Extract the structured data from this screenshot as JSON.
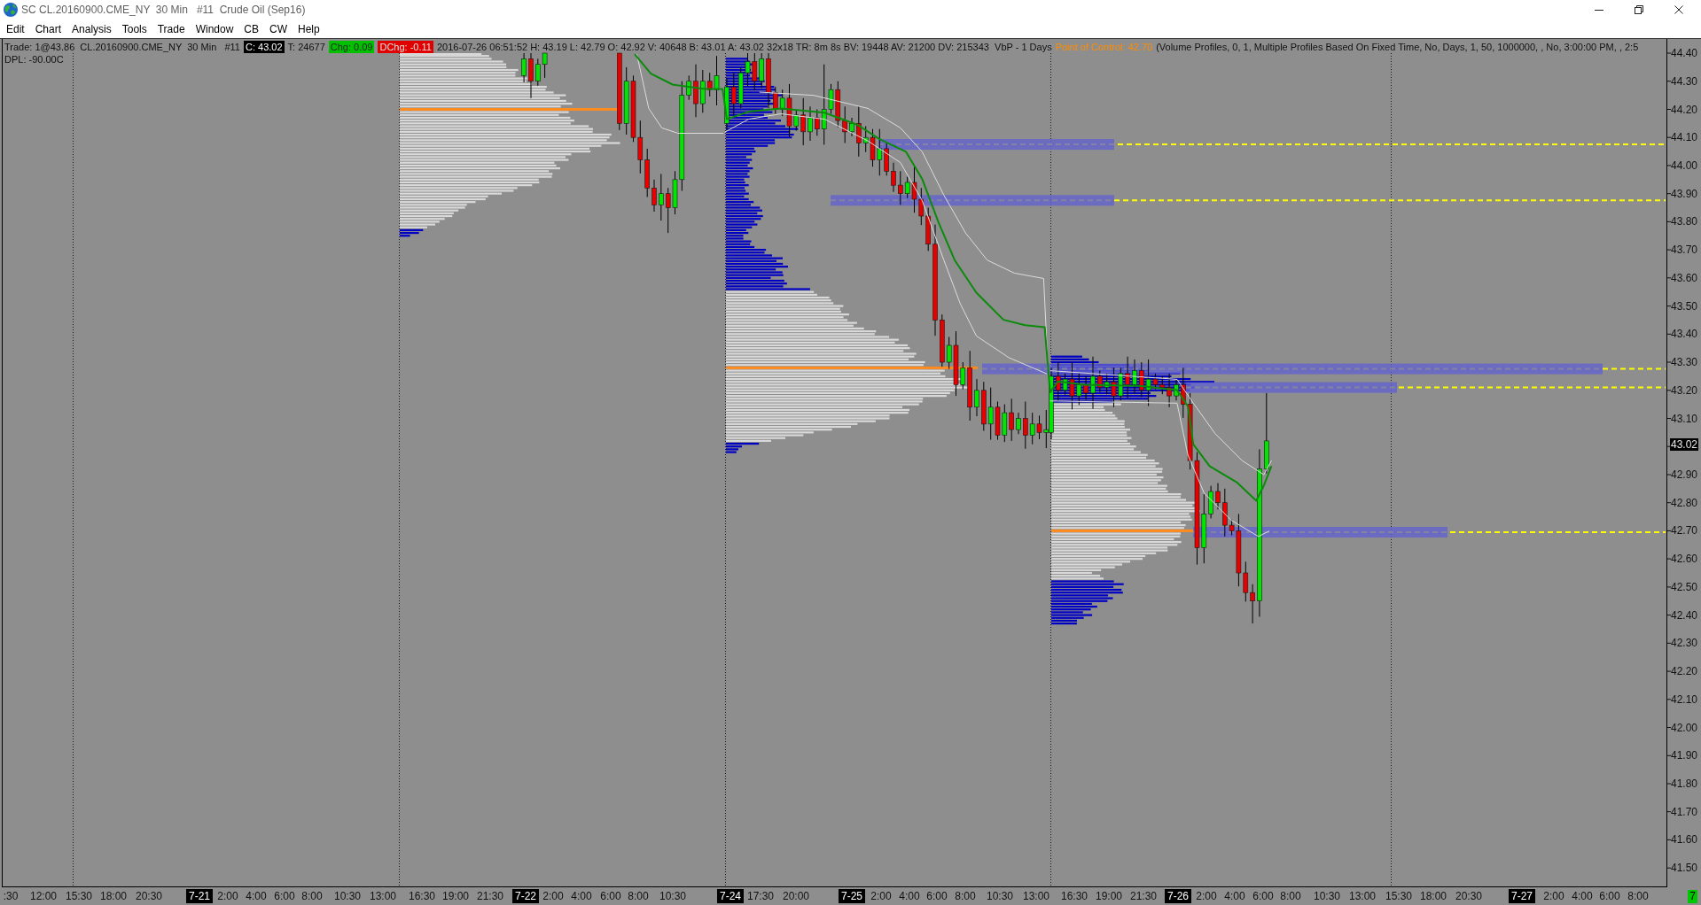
{
  "window": {
    "title": "SC CL.20160900.CME_NY  30 Min   #11  Crude Oil (Sep16)"
  },
  "menu": [
    "Edit",
    "Chart",
    "Analysis",
    "Tools",
    "Trade",
    "Window",
    "CB",
    "CW",
    "Help"
  ],
  "chart": {
    "info_line": [
      {
        "kind": "plain",
        "text": "Trade: 1@43.86  CL.20160900.CME_NY  30 Min   #11"
      },
      {
        "kind": "inverse",
        "text": "C: 43.02"
      },
      {
        "kind": "plain",
        "text": "T: 24677"
      },
      {
        "kind": "up",
        "text": "Chg: 0.09"
      },
      {
        "kind": "down",
        "text": "DChg: -0.11"
      },
      {
        "kind": "plain",
        "text": "2016-07-26 06:51:52 H: 43.19 L: 42.79 O: 42.92 V: 40648 B: 43.01 A: 43.02 32x18 TR: 8m 8s BV: 19448 AV: 21200 DV: 215343  VbP - 1 Days"
      },
      {
        "kind": "accent",
        "text": "Point of Control: 42.70"
      },
      {
        "kind": "plain",
        "text": "(Volume Profiles, 0, 1, Multiple Profiles Based On Fixed Time, No, Days, 1, 50, 1000000, , No, 3:00:00 PM, , 2:5"
      }
    ],
    "info_line_2": "DPL: -90.00C",
    "price_axis": [
      {
        "kind": "tick",
        "text": "44.40"
      },
      {
        "kind": "tick",
        "text": "44.30"
      },
      {
        "kind": "tick",
        "text": "44.20"
      },
      {
        "kind": "tick",
        "text": "44.10"
      },
      {
        "kind": "tick",
        "text": "44.00"
      },
      {
        "kind": "tick",
        "text": "43.90"
      },
      {
        "kind": "tick",
        "text": "43.80"
      },
      {
        "kind": "tick",
        "text": "43.70"
      },
      {
        "kind": "tick",
        "text": "43.60"
      },
      {
        "kind": "tick",
        "text": "43.50"
      },
      {
        "kind": "tick",
        "text": "43.40"
      },
      {
        "kind": "tick",
        "text": "43.30"
      },
      {
        "kind": "tick",
        "text": "43.20"
      },
      {
        "kind": "tick",
        "text": "43.10"
      },
      {
        "kind": "last_price",
        "text": "43.02"
      },
      {
        "kind": "tick",
        "text": "42.90"
      },
      {
        "kind": "tick",
        "text": "42.80"
      },
      {
        "kind": "tick",
        "text": "42.70"
      },
      {
        "kind": "tick",
        "text": "42.60"
      },
      {
        "kind": "tick",
        "text": "42.50"
      },
      {
        "kind": "tick",
        "text": "42.40"
      },
      {
        "kind": "tick",
        "text": "42.30"
      },
      {
        "kind": "tick",
        "text": "42.20"
      },
      {
        "kind": "tick",
        "text": "42.10"
      },
      {
        "kind": "tick",
        "text": "42.00"
      },
      {
        "kind": "tick",
        "text": "41.90"
      },
      {
        "kind": "tick",
        "text": "41.80"
      },
      {
        "kind": "tick",
        "text": "41.70"
      },
      {
        "kind": "tick",
        "text": "41.60"
      },
      {
        "kind": "tick",
        "text": "41.50"
      }
    ],
    "time_axis": [
      {
        "kind": "time",
        "text": ":30"
      },
      {
        "kind": "time",
        "text": "12:00"
      },
      {
        "kind": "time",
        "text": "15:30"
      },
      {
        "kind": "time",
        "text": "18:00"
      },
      {
        "kind": "time",
        "text": "20:30"
      },
      {
        "kind": "date",
        "text": "7-21"
      },
      {
        "kind": "time",
        "text": "2:00"
      },
      {
        "kind": "time",
        "text": "4:00"
      },
      {
        "kind": "time",
        "text": "6:00"
      },
      {
        "kind": "time",
        "text": "8:00"
      },
      {
        "kind": "time",
        "text": "10:30"
      },
      {
        "kind": "time",
        "text": "13:00"
      },
      {
        "kind": "time",
        "text": "16:30"
      },
      {
        "kind": "time",
        "text": "19:00"
      },
      {
        "kind": "time",
        "text": "21:30"
      },
      {
        "kind": "date",
        "text": "7-22"
      },
      {
        "kind": "time",
        "text": "2:00"
      },
      {
        "kind": "time",
        "text": "4:00"
      },
      {
        "kind": "time",
        "text": "6:00"
      },
      {
        "kind": "time",
        "text": "8:00"
      },
      {
        "kind": "time",
        "text": "10:30"
      },
      {
        "kind": "date",
        "text": "7-24"
      },
      {
        "kind": "time",
        "text": "17:30"
      },
      {
        "kind": "time",
        "text": "20:00"
      },
      {
        "kind": "date",
        "text": "7-25"
      },
      {
        "kind": "time",
        "text": "2:00"
      },
      {
        "kind": "time",
        "text": "4:00"
      },
      {
        "kind": "time",
        "text": "6:00"
      },
      {
        "kind": "time",
        "text": "8:00"
      },
      {
        "kind": "time",
        "text": "10:30"
      },
      {
        "kind": "time",
        "text": "13:00"
      },
      {
        "kind": "time",
        "text": "16:30"
      },
      {
        "kind": "time",
        "text": "19:00"
      },
      {
        "kind": "time",
        "text": "21:30"
      },
      {
        "kind": "date",
        "text": "7-26"
      },
      {
        "kind": "time",
        "text": "2:00"
      },
      {
        "kind": "time",
        "text": "4:00"
      },
      {
        "kind": "time",
        "text": "6:00"
      },
      {
        "kind": "time",
        "text": "8:00"
      },
      {
        "kind": "time",
        "text": "10:30"
      },
      {
        "kind": "time",
        "text": "13:00"
      },
      {
        "kind": "time",
        "text": "15:30"
      },
      {
        "kind": "time",
        "text": "18:00"
      },
      {
        "kind": "time",
        "text": "20:30"
      },
      {
        "kind": "date",
        "text": "7-27"
      },
      {
        "kind": "time",
        "text": "2:00"
      },
      {
        "kind": "time",
        "text": "4:00"
      },
      {
        "kind": "time",
        "text": "6:00"
      },
      {
        "kind": "time",
        "text": "8:00"
      }
    ],
    "corner_indicator": "7"
  }
}
